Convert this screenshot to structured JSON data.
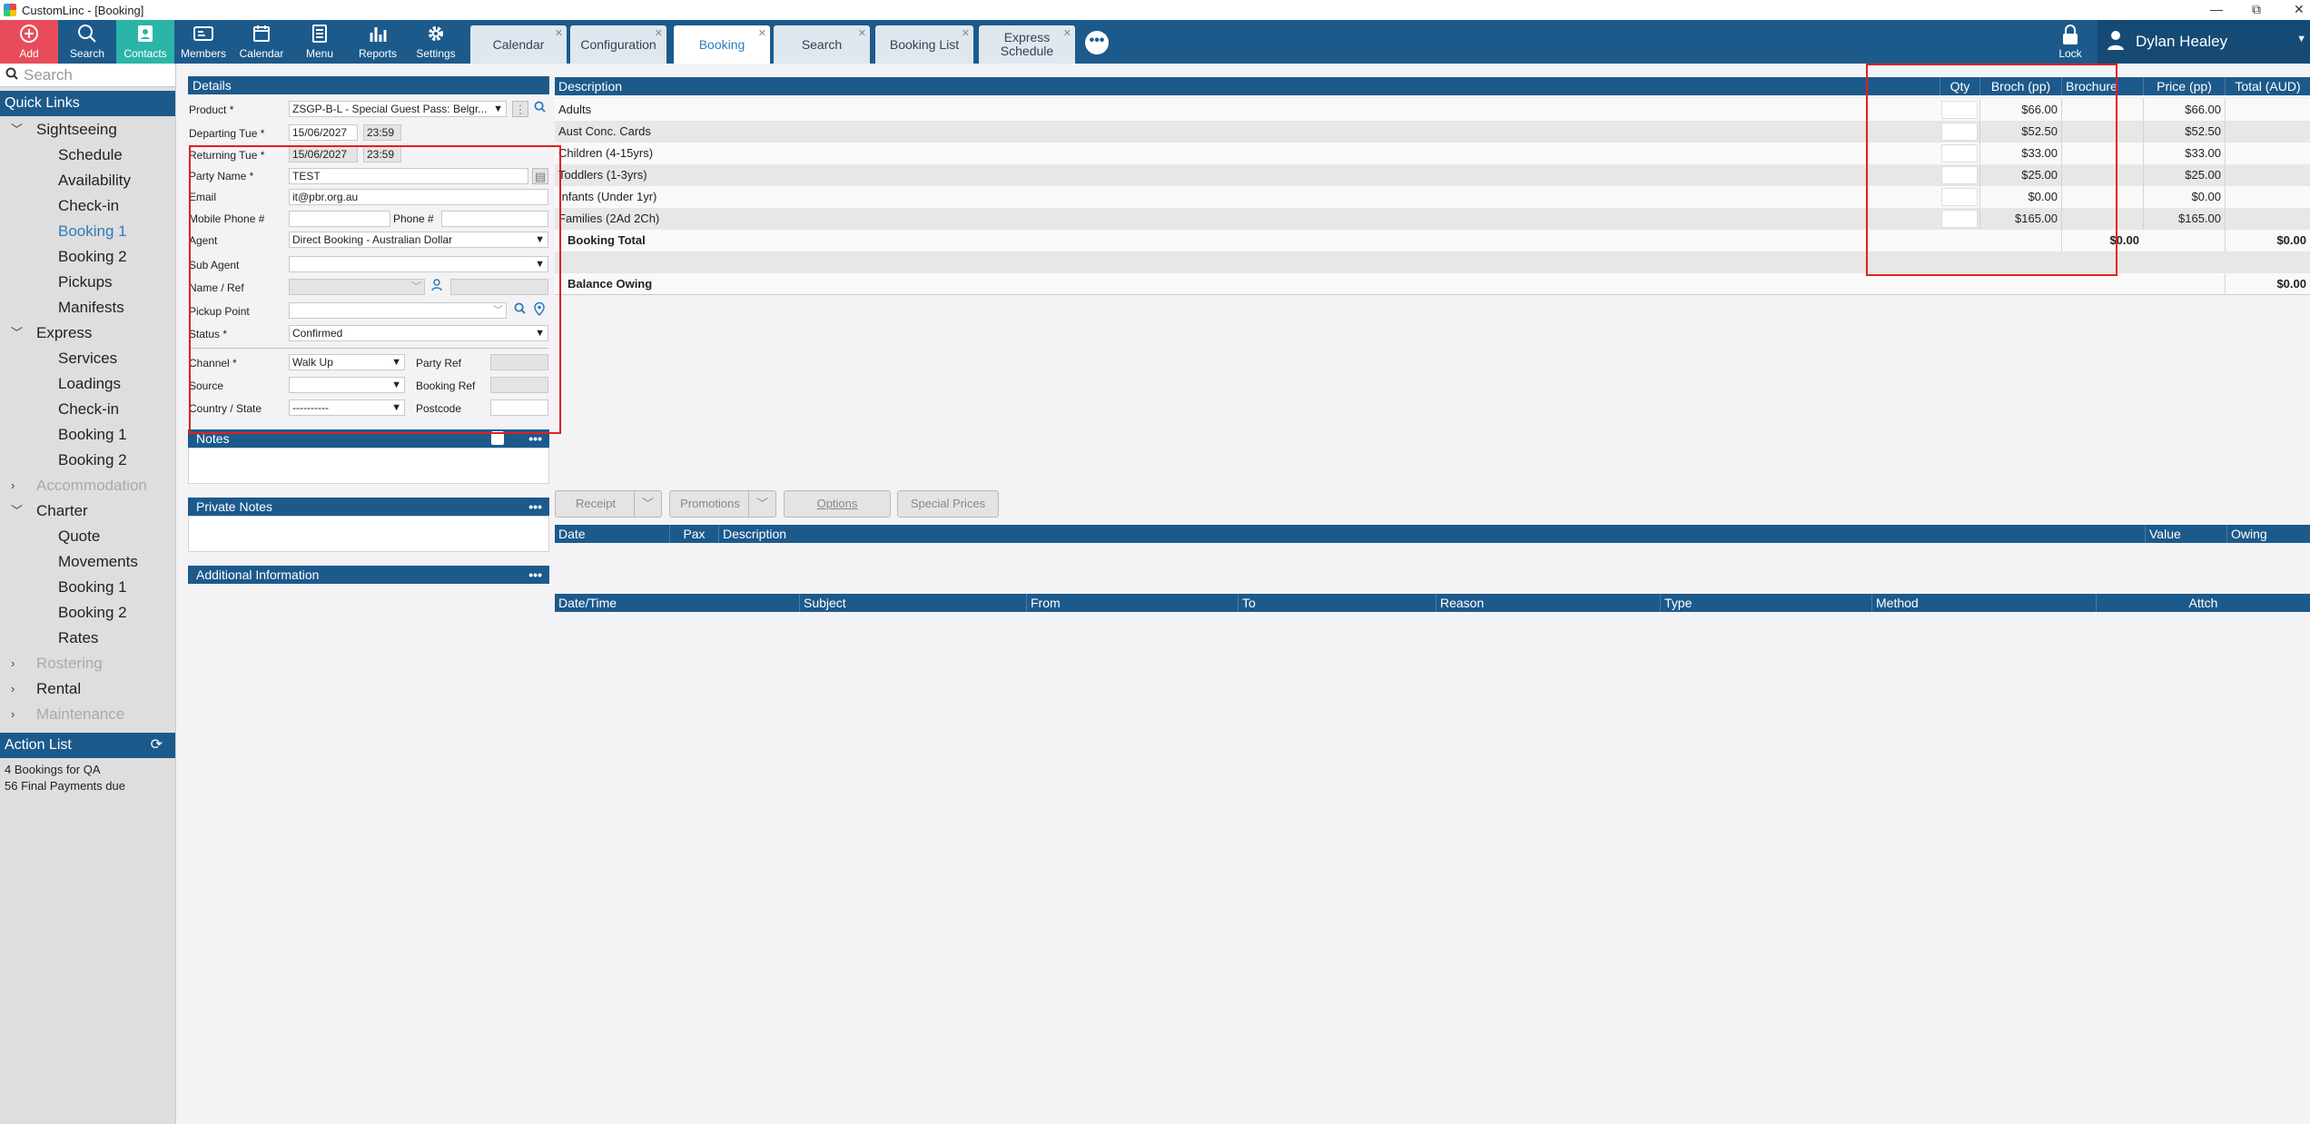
{
  "window": {
    "title": "CustomLinc - [Booking]",
    "controls": [
      "—",
      "⧉",
      "✕"
    ]
  },
  "toolbar": {
    "buttons": [
      {
        "label": "Add",
        "icon": "plus-circle-icon"
      },
      {
        "label": "Search",
        "icon": "search-icon"
      },
      {
        "label": "Contacts",
        "icon": "contacts-icon"
      },
      {
        "label": "Members",
        "icon": "id-card-icon"
      },
      {
        "label": "Calendar",
        "icon": "calendar-icon"
      },
      {
        "label": "Menu",
        "icon": "menu-icon"
      },
      {
        "label": "Reports",
        "icon": "bar-chart-icon"
      },
      {
        "label": "Settings",
        "icon": "gear-icon"
      }
    ],
    "tabs": [
      {
        "label": "Calendar"
      },
      {
        "label": "Configuration"
      },
      {
        "label": "Booking"
      },
      {
        "label": "Search"
      },
      {
        "label": "Booking List"
      },
      {
        "label": "Express Schedule"
      }
    ],
    "more": "•••",
    "lock_label": "Lock",
    "user_name": "Dylan Healey",
    "colors": {
      "toolbar": "#1c5a8c",
      "add": "#e84c5a",
      "contacts": "#2bb5a8"
    }
  },
  "sidebar": {
    "search_placeholder": "Search",
    "quick_links": "Quick Links",
    "groups": [
      {
        "label": "Sightseeing",
        "items": [
          "Schedule",
          "Availability",
          "Check-in",
          "Booking 1",
          "Booking 2",
          "Pickups",
          "Manifests"
        ]
      },
      {
        "label": "Express",
        "items": [
          "Services",
          "Loadings",
          "Check-in",
          "Booking 1",
          "Booking 2"
        ]
      },
      {
        "label": "Accommodation"
      },
      {
        "label": "Charter",
        "items": [
          "Quote",
          "Movements",
          "Booking 1",
          "Booking 2",
          "Rates"
        ]
      },
      {
        "label": "Rostering"
      },
      {
        "label": "Rental"
      },
      {
        "label": "Maintenance"
      }
    ],
    "action_list": "Action List",
    "actions": [
      "4 Bookings for QA",
      "56 Final Payments due"
    ]
  },
  "details": {
    "title": "Details",
    "product_label": "Product *",
    "product_value": "ZSGP-B-L - Special Guest Pass: Belgr...",
    "departing_label": "Departing Tue *",
    "departing_date": "15/06/2027",
    "departing_time": "23:59",
    "returning_label": "Returning Tue *",
    "returning_date": "15/06/2027",
    "returning_time": "23:59",
    "party_label": "Party Name *",
    "party_value": "TEST",
    "email_label": "Email",
    "email_value": "it@pbr.org.au",
    "mobile_label": "Mobile Phone #",
    "phone_label": "Phone #",
    "agent_label": "Agent",
    "agent_value": "Direct Booking - Australian Dollar",
    "subagent_label": "Sub Agent",
    "nameref_label": "Name / Ref",
    "pickup_label": "Pickup Point",
    "status_label": "Status *",
    "status_value": "Confirmed",
    "channel_label": "Channel *",
    "channel_value": "Walk Up",
    "partyref_label": "Party Ref",
    "source_label": "Source",
    "bookingref_label": "Booking Ref",
    "country_label": "Country / State",
    "country_value": "----------",
    "postcode_label": "Postcode"
  },
  "notes": {
    "title": "Notes"
  },
  "private_notes": {
    "title": "Private Notes"
  },
  "additional": {
    "title": "Additional Information"
  },
  "fare_grid": {
    "headers": [
      "Description",
      "Qty",
      "Broch (pp)",
      "Brochure",
      "Price (pp)",
      "Total (AUD)"
    ],
    "rows": [
      {
        "desc": "Adults",
        "broch": "$66.00",
        "price": "$66.00"
      },
      {
        "desc": "Aust Conc. Cards",
        "broch": "$52.50",
        "price": "$52.50"
      },
      {
        "desc": "Children (4-15yrs)",
        "broch": "$33.00",
        "price": "$33.00"
      },
      {
        "desc": "Toddlers (1-3yrs)",
        "broch": "$25.00",
        "price": "$25.00"
      },
      {
        "desc": "Infants (Under 1yr)",
        "broch": "$0.00",
        "price": "$0.00"
      },
      {
        "desc": "Families (2Ad 2Ch)",
        "broch": "$165.00",
        "price": "$165.00"
      }
    ],
    "booking_total_label": "Booking Total",
    "booking_total_brochure": "$0.00",
    "booking_total_total": "$0.00",
    "balance_label": "Balance Owing",
    "balance_value": "$0.00"
  },
  "actions_bar": {
    "receipt": "Receipt",
    "promotions": "Promotions",
    "options": "Options",
    "special_prices": "Special Prices"
  },
  "payments_grid": {
    "headers": [
      "Date",
      "Pax",
      "Description",
      "Value",
      "Owing"
    ]
  },
  "history_grid": {
    "headers": [
      "Date/Time",
      "Subject",
      "From",
      "To",
      "Reason",
      "Type",
      "Method",
      "Attch"
    ]
  }
}
